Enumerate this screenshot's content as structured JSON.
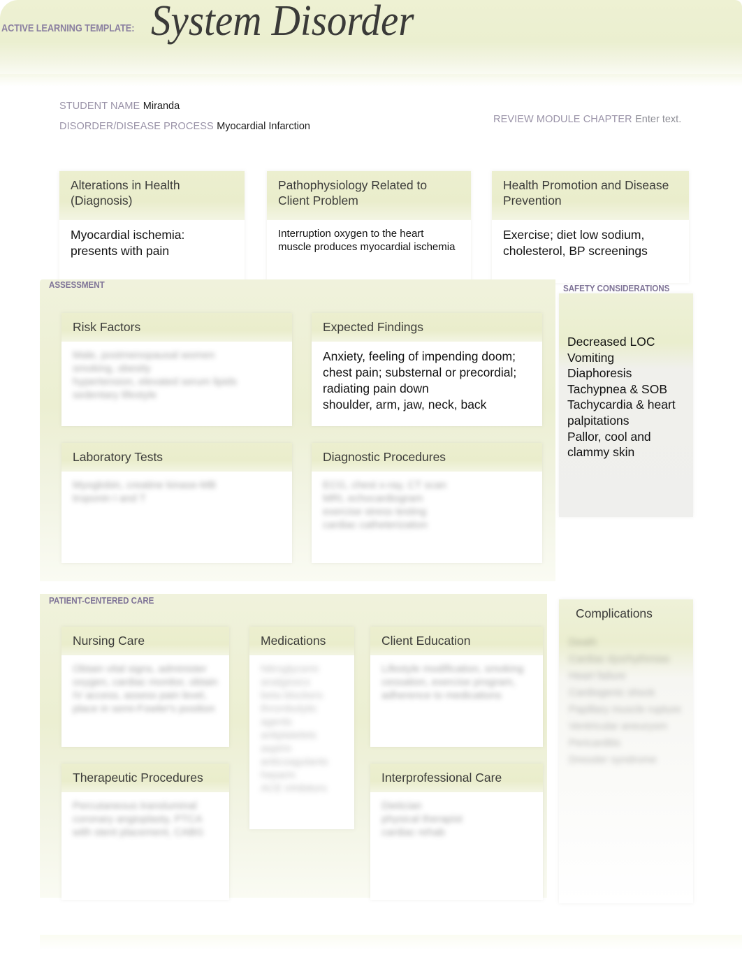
{
  "header": {
    "kicker": "ACTIVE LEARNING TEMPLATE:",
    "title": "System Disorder"
  },
  "meta": {
    "student_name_label": "STUDENT NAME",
    "student_name_value": "Miranda",
    "disorder_label": "DISORDER/DISEASE PROCESS",
    "disorder_value": "Myocardial Infarction",
    "review_label": "REVIEW MODULE CHAPTER",
    "review_value": "Enter text."
  },
  "top_boxes": [
    {
      "title": "Alterations in Health (Diagnosis)",
      "body": "Myocardial ischemia: presents with pain"
    },
    {
      "title": "Pathophysiology Related to Client Problem",
      "body": "Interruption oxygen to the heart muscle produces myocardial ischemia"
    },
    {
      "title": "Health Promotion and Disease Prevention",
      "body": "Exercise; diet low sodium, cholesterol, BP screenings"
    }
  ],
  "assessment": {
    "section_label": "ASSESSMENT",
    "risk_factors": {
      "title": "Risk Factors",
      "body": "Male, postmenopausal women\nsmoking, obesity\nhypertension, elevated serum lipids\nsedentary lifestyle"
    },
    "expected_findings": {
      "title": "Expected Findings",
      "body": "Anxiety, feeling of impending doom; chest pain; substernal or precordial; radiating pain down\nshoulder, arm, jaw, neck, back"
    },
    "laboratory_tests": {
      "title": "Laboratory Tests",
      "body": "Myoglobin, creatine kinase-MB\ntroponin I and T"
    },
    "diagnostic_procedures": {
      "title": "Diagnostic Procedures",
      "body": "ECG, chest x-ray, CT scan\nMRI, echocardiogram\nexercise stress testing\ncardiac catheterization"
    }
  },
  "safety": {
    "section_label": "SAFETY CONSIDERATIONS",
    "body": "Decreased LOC\nVomiting\nDiaphoresis\nTachypnea & SOB\nTachycardia & heart palpitations\nPallor, cool and clammy skin"
  },
  "patient_centered_care": {
    "section_label": "PATIENT-CENTERED CARE",
    "nursing_care": {
      "title": "Nursing Care",
      "body": "Obtain vital signs, administer oxygen, cardiac monitor, obtain IV access, assess pain level, place in semi-Fowler's position"
    },
    "medications": {
      "title": "Medications",
      "body": "Nitroglycerin\nanalgesics\nbeta blockers\nthrombolytic agents\nantiplatelets\naspirin\nanticoagulants\nheparin\nACE inhibitors"
    },
    "client_education": {
      "title": "Client Education",
      "body": "Lifestyle modification, smoking cessation, exercise program, adherence to medications"
    },
    "therapeutic_procedures": {
      "title": "Therapeutic Procedures",
      "body": "Percutaneous transluminal coronary angioplasty, PTCA with stent placement, CABG"
    },
    "interprofessional_care": {
      "title": "Interprofessional Care",
      "body": "Dietician\nphysical therapist\ncardiac rehab"
    }
  },
  "complications": {
    "title": "Complications",
    "body": "Death\nCardiac dysrhythmias\nHeart failure\nCardiogenic shock\nPapillary muscle rupture\nVentricular aneurysm\nPericarditis\nDressler syndrome"
  },
  "colors": {
    "band_green": "#ecefcf",
    "label_purple": "#7f7497",
    "text_dark": "#121212",
    "meta_label": "#9a93a8"
  }
}
